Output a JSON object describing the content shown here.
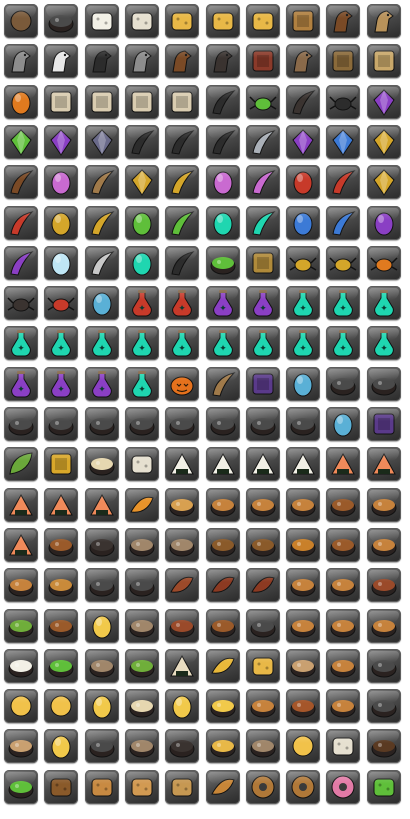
{
  "grid": {
    "columns": 10,
    "rows": 20,
    "rows_icons": [
      [
        "magic-wand-icon",
        "cooking-pot-icon",
        "rice-cakes-icon",
        "mooncake-icon",
        "cheese-wheel-icon",
        "cheese-wedge-icon",
        "cheese-wedge-icon",
        "gift-basket-icon",
        "brown-horse-icon",
        "tan-horse-icon"
      ],
      [
        "grey-zebra-icon",
        "white-horse-icon",
        "black-horse-icon",
        "grey-horse-icon",
        "brown-horse-head-icon",
        "dark-horse-icon",
        "saddle-icon",
        "horse-armor-icon",
        "harness-icon",
        "treasure-map-icon"
      ],
      [
        "orange-egg-icon",
        "scroll-icon",
        "scroll-icon",
        "scroll-icon",
        "scroll-icon",
        "black-feather-icon",
        "green-beetle-icon",
        "dark-fang-icon",
        "black-spider-icon",
        "purple-gem-icon"
      ],
      [
        "green-crystal-icon",
        "purple-eye-icon",
        "spiked-shell-icon",
        "black-claw-icon",
        "black-wing-icon",
        "black-horn-icon",
        "steel-blade-icon",
        "purple-gem-icon",
        "blue-eye-icon",
        "gold-gem-icon"
      ],
      [
        "brown-horn-icon",
        "rainbow-egg-icon",
        "horn-icon",
        "gold-gem-icon",
        "gold-horn-icon",
        "rainbow-egg-icon",
        "rainbow-horn-icon",
        "red-egg-icon",
        "red-horn-icon",
        "gold-gem-icon"
      ],
      [
        "red-horn-icon",
        "gold-egg-icon",
        "gold-horn-icon",
        "green-egg-icon",
        "green-horn-icon",
        "teal-egg-icon",
        "teal-horn-icon",
        "blue-egg-icon",
        "blue-horn-icon",
        "purple-egg-icon"
      ],
      [
        "purple-horn-icon",
        "crystal-egg-icon",
        "silver-horn-icon",
        "teal-egg-icon",
        "black-claw-icon",
        "green-teapot-icon",
        "treasure-chest-icon",
        "gold-crab-icon",
        "gold-spider-icon",
        "orange-spider-icon"
      ],
      [
        "dark-monster-icon",
        "red-monster-icon",
        "orb-icon",
        "red-potion-icon",
        "red-potion-icon",
        "purple-potion-icon",
        "purple-potion-icon",
        "teal-potion-icon",
        "teal-potion-icon",
        "teal-potion-icon"
      ],
      [
        "teal-potion-icon",
        "teal-potion-icon",
        "teal-potion-icon",
        "teal-potion-icon",
        "teal-potion-icon",
        "teal-potion-icon",
        "teal-potion-icon",
        "teal-potion-icon",
        "teal-potion-icon",
        "teal-potion-icon"
      ],
      [
        "purple-potion-icon",
        "purple-potion-icon",
        "purple-potion-icon",
        "teal-potion-icon",
        "pumpkin-icon",
        "horn-icon",
        "photo-frame-icon",
        "magic-orb-icon",
        "iron-pot-icon",
        "iron-pot-icon"
      ],
      [
        "iron-pot-icon",
        "iron-pot-icon",
        "iron-pot-icon",
        "iron-pot-icon",
        "iron-pot-icon",
        "iron-pot-icon",
        "iron-pot-icon",
        "iron-pot-icon",
        "magic-orb-icon",
        "photo-frame-icon"
      ],
      [
        "herb-leaf-icon",
        "medal-icon",
        "noodle-cup-icon",
        "cake-box-icon",
        "rice-ball-icon",
        "rice-ball-icon",
        "rice-ball-icon",
        "rice-ball-icon",
        "sushi-icon",
        "sushi-icon"
      ],
      [
        "sushi-icon",
        "sushi-icon",
        "sushi-icon",
        "fried-shrimp-icon",
        "pasta-bowl-icon",
        "soup-bowl-icon",
        "soup-bowl-icon",
        "soup-bowl-icon",
        "roast-icon",
        "soup-bowl-icon"
      ],
      [
        "sushi-icon",
        "roast-icon",
        "dark-bowl-icon",
        "vegetable-bowl-icon",
        "vegetable-bowl-icon",
        "stir-fry-icon",
        "stir-fry-icon",
        "fried-fish-icon",
        "roast-icon",
        "soup-bowl-icon"
      ],
      [
        "soup-bowl-icon",
        "pudding-icon",
        "stew-pot-icon",
        "stew-pot-icon",
        "sausage-icon",
        "steak-icon",
        "steak-icon",
        "soup-bowl-icon",
        "soup-bowl-icon",
        "meatball-icon"
      ],
      [
        "salad-icon",
        "roast-chicken-icon",
        "fried-egg-icon",
        "vegetable-bowl-icon",
        "grilled-meat-icon",
        "roast-chicken-icon",
        "stew-pot-icon",
        "cream-soup-icon",
        "cream-soup-icon",
        "cream-soup-icon"
      ],
      [
        "rice-bowl-icon",
        "green-salad-icon",
        "vegetable-bowl-icon",
        "salad-icon",
        "dumpling-icon",
        "fries-icon",
        "cheese-icon",
        "mushroom-dish-icon",
        "soup-bowl-icon",
        "stew-pot-icon"
      ],
      [
        "omelette-icon",
        "omelette-icon",
        "fried-egg-icon",
        "noodle-bowl-icon",
        "fried-egg-icon",
        "egg-dish-icon",
        "soup-bowl-icon",
        "meat-stew-icon",
        "soup-bowl-icon",
        "stew-pot-icon"
      ],
      [
        "dish-icon",
        "boiled-egg-icon",
        "pot-icon",
        "vegetable-bowl-icon",
        "dark-bowl-icon",
        "cheese-dish-icon",
        "vegetable-bowl-icon",
        "omelette-icon",
        "cake-icon",
        "chocolate-dish-icon"
      ],
      [
        "green-salad-icon",
        "cookie-icon",
        "waffle-icon",
        "cracker-icon",
        "biscuit-icon",
        "croissant-icon",
        "donut-icon",
        "chocolate-donut-icon",
        "pink-donut-icon",
        "green-pie-icon",
        "baguette-icon"
      ]
    ]
  }
}
